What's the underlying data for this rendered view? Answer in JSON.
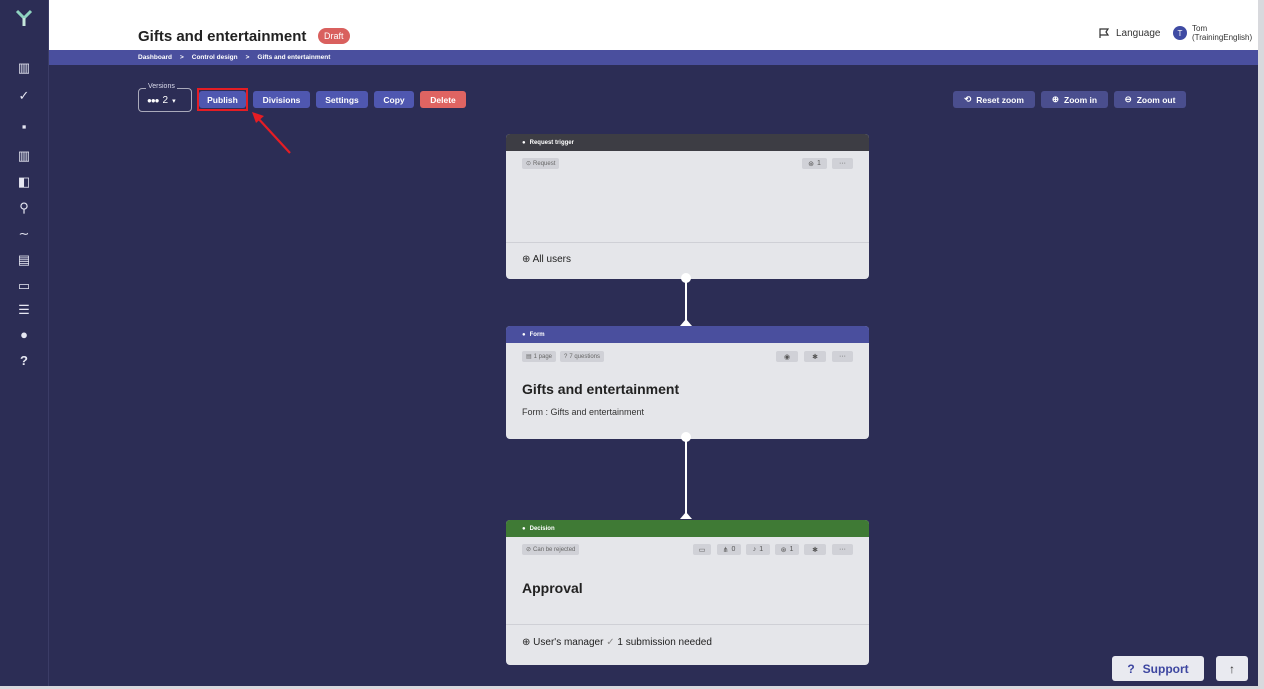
{
  "app": {
    "title": "Gifts and entertainment",
    "status_badge": "Draft"
  },
  "header": {
    "language_label": "Language",
    "user_initial": "T",
    "user_name_line1": "Tom",
    "user_name_line2": "(TrainingEnglish)"
  },
  "breadcrumb": [
    "Dashboard",
    "Control design",
    "Gifts and entertainment"
  ],
  "breadcrumb_separator": ">",
  "toolbar": {
    "versions_label": "Versions",
    "versions_value": "2",
    "publish": "Publish",
    "divisions": "Divisions",
    "settings": "Settings",
    "copy": "Copy",
    "delete": "Delete",
    "reset_zoom": "Reset zoom",
    "zoom_in": "Zoom in",
    "zoom_out": "Zoom out"
  },
  "cards": {
    "trigger": {
      "header": "Request trigger",
      "chip": "Request",
      "count": "1",
      "footer": "All users"
    },
    "form": {
      "header": "Form",
      "chip_pages": "1 page",
      "chip_questions": "7 questions",
      "title": "Gifts and entertainment",
      "subtitle": "Form : Gifts and entertainment"
    },
    "decision": {
      "header": "Decision",
      "chip": "Can be rejected",
      "count_a": "0",
      "count_b": "1",
      "count_c": "1",
      "title": "Approval",
      "footer_who": "User's manager",
      "footer_need": "1 submission needed"
    }
  },
  "support": {
    "label": "Support"
  },
  "colors": {
    "bg": "#2c2d55",
    "accent": "#4f57b0",
    "danger": "#df6462",
    "trigger_head": "#3d3d44",
    "form_head": "#4a4f9e",
    "decision_head": "#3f7a35"
  }
}
